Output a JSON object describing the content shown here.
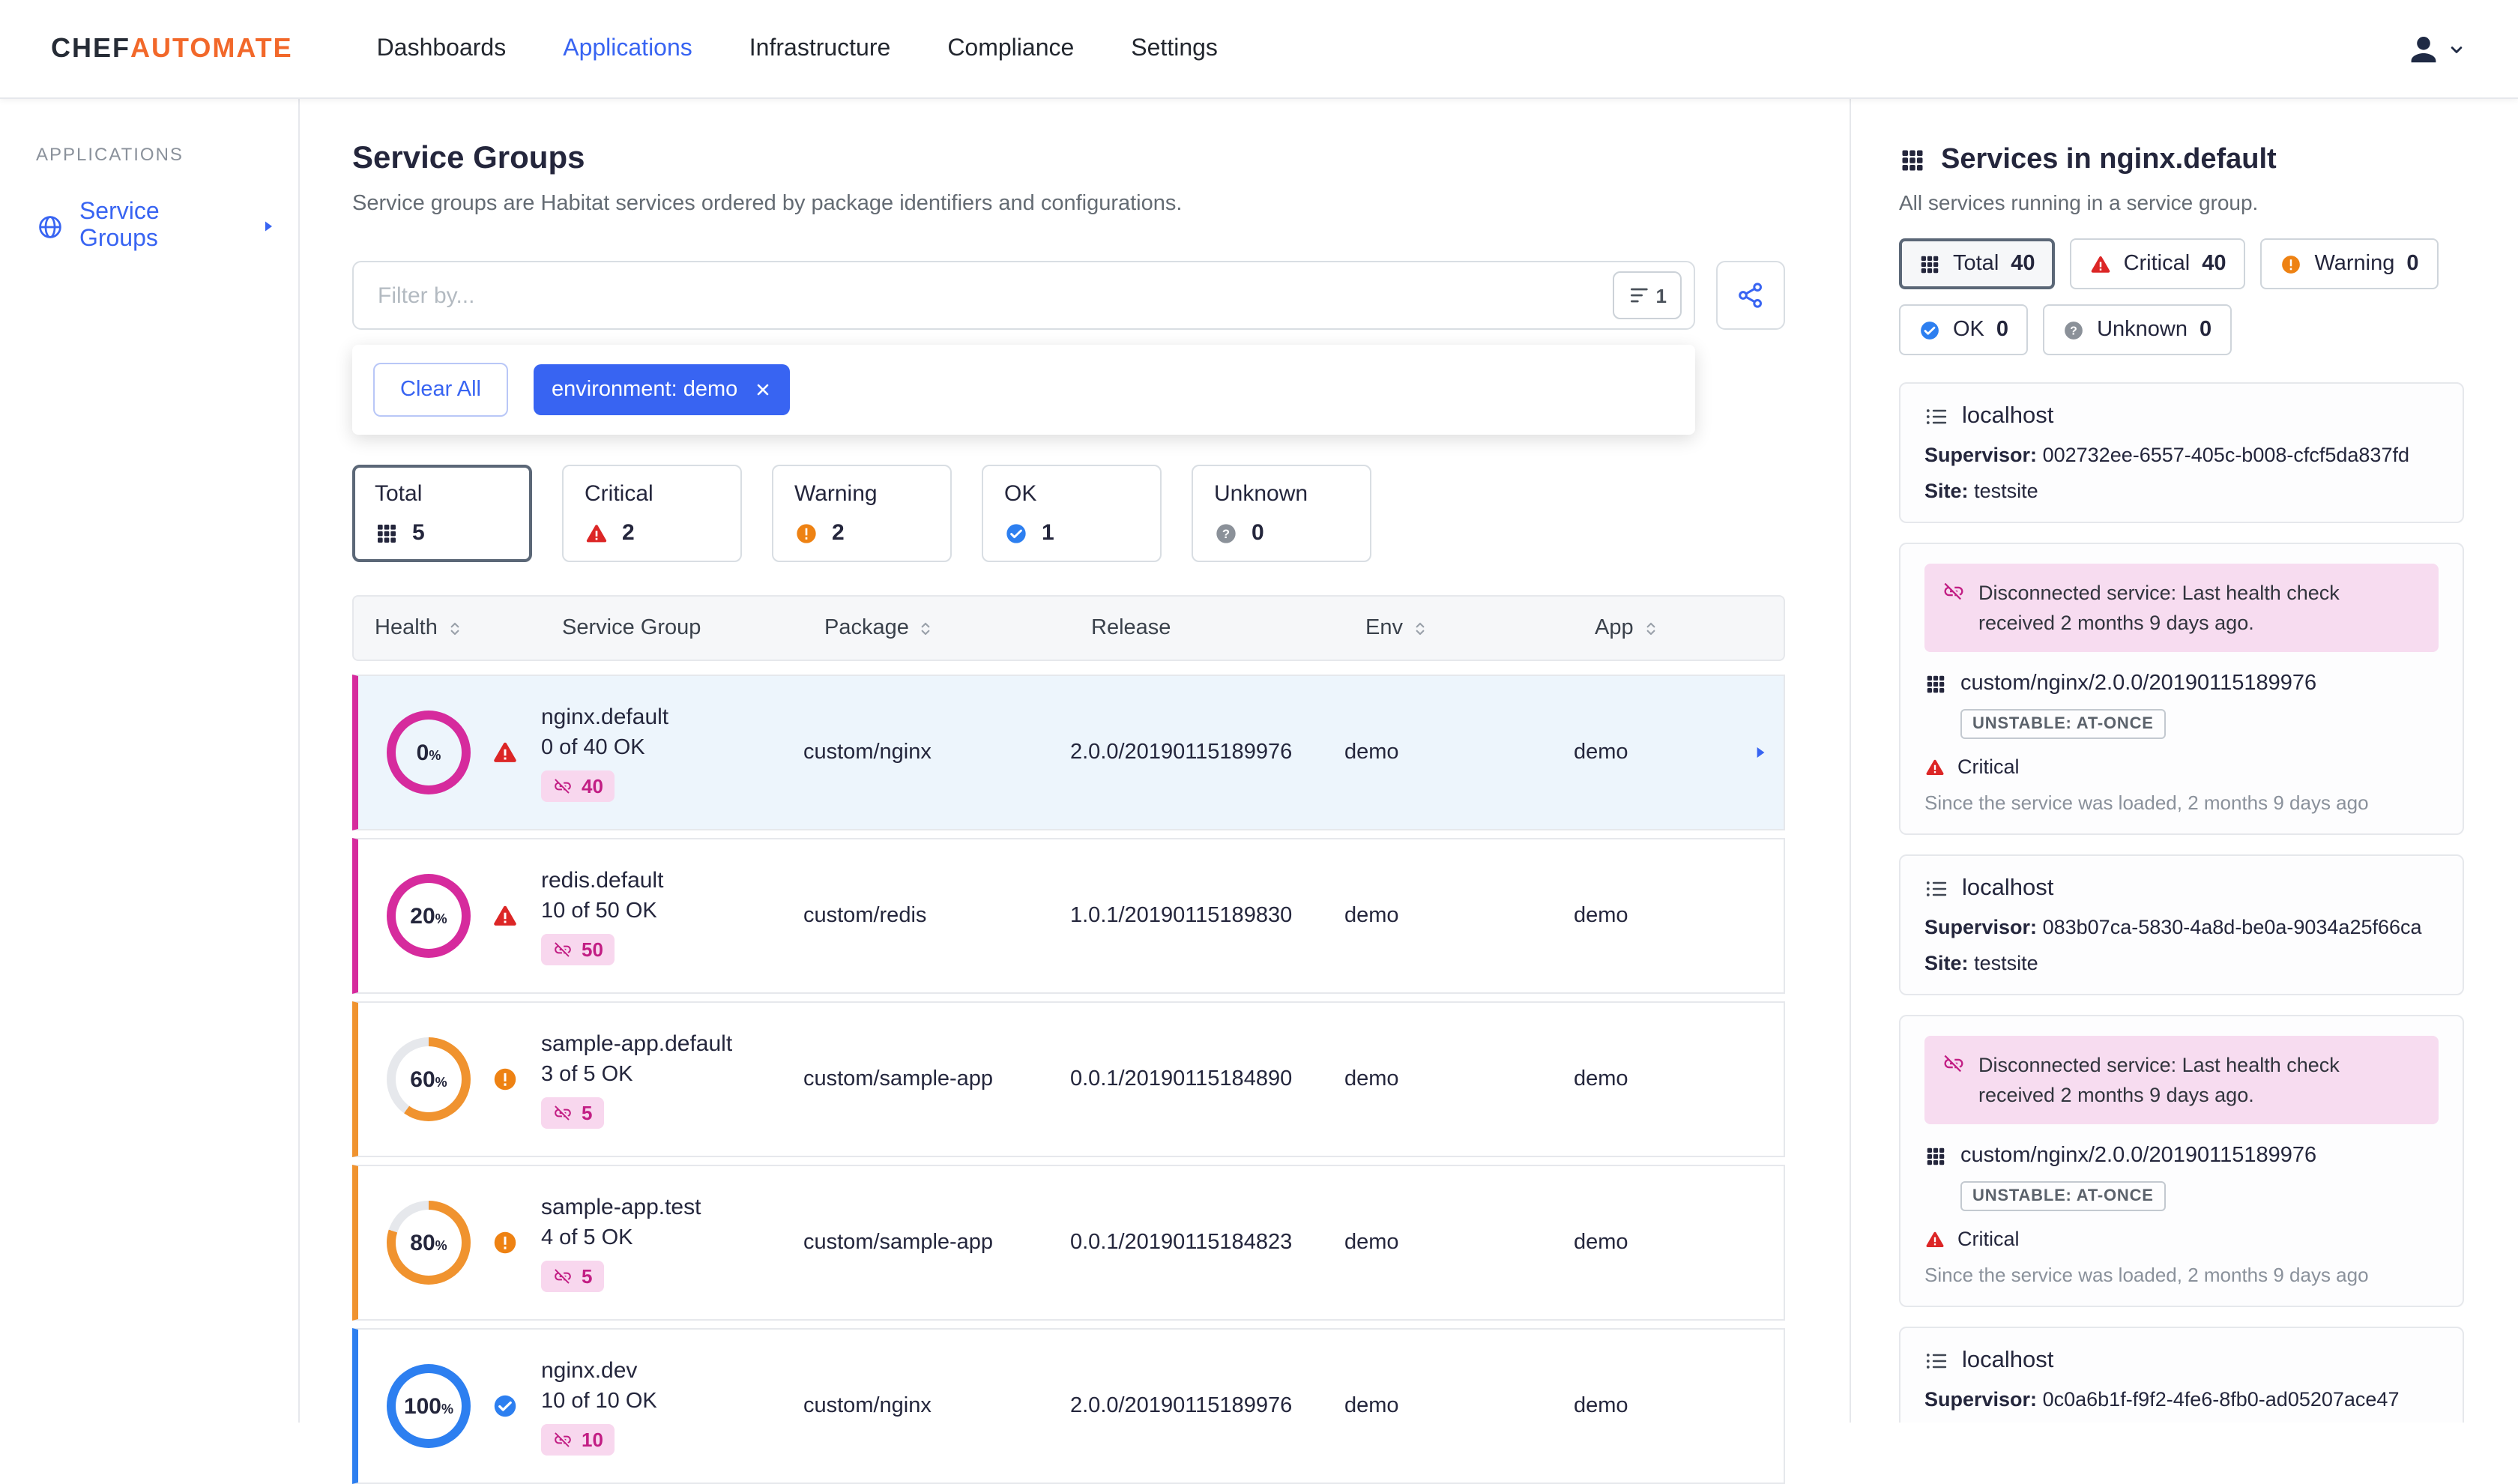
{
  "brand": {
    "chef": "CHEF",
    "automate": "AUTOMATE"
  },
  "nav": {
    "items": [
      {
        "label": "Dashboards"
      },
      {
        "label": "Applications",
        "active": true
      },
      {
        "label": "Infrastructure"
      },
      {
        "label": "Compliance"
      },
      {
        "label": "Settings"
      }
    ]
  },
  "sidebar": {
    "section": "APPLICATIONS",
    "items": [
      {
        "label": "Service Groups",
        "active": true
      }
    ]
  },
  "main": {
    "title": "Service Groups",
    "subtitle": "Service groups are Habitat services ordered by package identifiers and configurations.",
    "filter": {
      "placeholder": "Filter by...",
      "badge_count": "1",
      "clear_all": "Clear All",
      "chips": [
        {
          "label": "environment: demo"
        }
      ]
    },
    "status_cards": [
      {
        "label": "Total",
        "count": "5",
        "status": "total",
        "selected": true
      },
      {
        "label": "Critical",
        "count": "2",
        "status": "critical"
      },
      {
        "label": "Warning",
        "count": "2",
        "status": "warning"
      },
      {
        "label": "OK",
        "count": "1",
        "status": "ok"
      },
      {
        "label": "Unknown",
        "count": "0",
        "status": "unknown"
      }
    ],
    "table": {
      "percent_suffix": "%",
      "columns": [
        {
          "label": "Health",
          "sortable": true
        },
        {
          "label": "Service Group",
          "sortable": false
        },
        {
          "label": "Package",
          "sortable": true
        },
        {
          "label": "Release",
          "sortable": false
        },
        {
          "label": "Env",
          "sortable": true
        },
        {
          "label": "App",
          "sortable": true
        }
      ],
      "rows": [
        {
          "percent": "0",
          "ring_fill": 100,
          "status": "critical",
          "name": "nginx.default",
          "ok_text": "0 of 40 OK",
          "disconnected_count": "40",
          "package": "custom/nginx",
          "release": "2.0.0/20190115189976",
          "env": "demo",
          "app": "demo",
          "selected": true
        },
        {
          "percent": "20",
          "ring_fill": 100,
          "status": "critical",
          "name": "redis.default",
          "ok_text": "10 of 50 OK",
          "disconnected_count": "50",
          "package": "custom/redis",
          "release": "1.0.1/20190115189830",
          "env": "demo",
          "app": "demo"
        },
        {
          "percent": "60",
          "ring_fill": 60,
          "status": "warning",
          "name": "sample-app.default",
          "ok_text": "3 of 5 OK",
          "disconnected_count": "5",
          "package": "custom/sample-app",
          "release": "0.0.1/20190115184890",
          "env": "demo",
          "app": "demo"
        },
        {
          "percent": "80",
          "ring_fill": 80,
          "status": "warning",
          "name": "sample-app.test",
          "ok_text": "4 of 5 OK",
          "disconnected_count": "5",
          "package": "custom/sample-app",
          "release": "0.0.1/20190115184823",
          "env": "demo",
          "app": "demo"
        },
        {
          "percent": "100",
          "ring_fill": 100,
          "status": "ok",
          "name": "nginx.dev",
          "ok_text": "10 of 10 OK",
          "disconnected_count": "10",
          "package": "custom/nginx",
          "release": "2.0.0/20190115189976",
          "env": "demo",
          "app": "demo"
        }
      ]
    }
  },
  "panel": {
    "title": "Services in nginx.default",
    "subtitle": "All services running in a service group.",
    "filters": [
      {
        "label": "Total",
        "count": "40",
        "status": "total",
        "selected": true
      },
      {
        "label": "Critical",
        "count": "40",
        "status": "critical"
      },
      {
        "label": "Warning",
        "count": "0",
        "status": "warning"
      },
      {
        "label": "OK",
        "count": "0",
        "status": "ok"
      },
      {
        "label": "Unknown",
        "count": "0",
        "status": "unknown"
      }
    ],
    "cards": [
      {
        "type": "host",
        "host": "localhost",
        "supervisor_label": "Supervisor:",
        "supervisor": "002732ee-6557-405c-b008-cfcf5da837fd",
        "site_label": "Site:",
        "site": "testsite"
      },
      {
        "type": "service",
        "notice": "Disconnected service: Last health check received 2 months 9 days ago.",
        "package": "custom/nginx/2.0.0/20190115189976",
        "health_badge": "UNSTABLE: AT-ONCE",
        "status_label": "Critical",
        "since": "Since the service was loaded, 2 months 9 days ago"
      },
      {
        "type": "host",
        "host": "localhost",
        "supervisor_label": "Supervisor:",
        "supervisor": "083b07ca-5830-4a8d-be0a-9034a25f66ca",
        "site_label": "Site:",
        "site": "testsite"
      },
      {
        "type": "service",
        "notice": "Disconnected service: Last health check received 2 months 9 days ago.",
        "package": "custom/nginx/2.0.0/20190115189976",
        "health_badge": "UNSTABLE: AT-ONCE",
        "status_label": "Critical",
        "since": "Since the service was loaded, 2 months 9 days ago"
      },
      {
        "type": "host",
        "host": "localhost",
        "supervisor_label": "Supervisor:",
        "supervisor": "0c0a6b1f-f9f2-4fe6-8fb0-ad05207ace47"
      }
    ]
  },
  "colors": {
    "primary": "#3864f2",
    "brand_orange": "#f2682a",
    "critical_ring": "#d62b9d",
    "critical_icon": "#dc2626",
    "warning": "#f0932f",
    "ok": "#2d7ff0",
    "unknown": "#8b9199",
    "badge_bg": "#f8d7ee",
    "notice_bg": "#f7dcf0"
  }
}
